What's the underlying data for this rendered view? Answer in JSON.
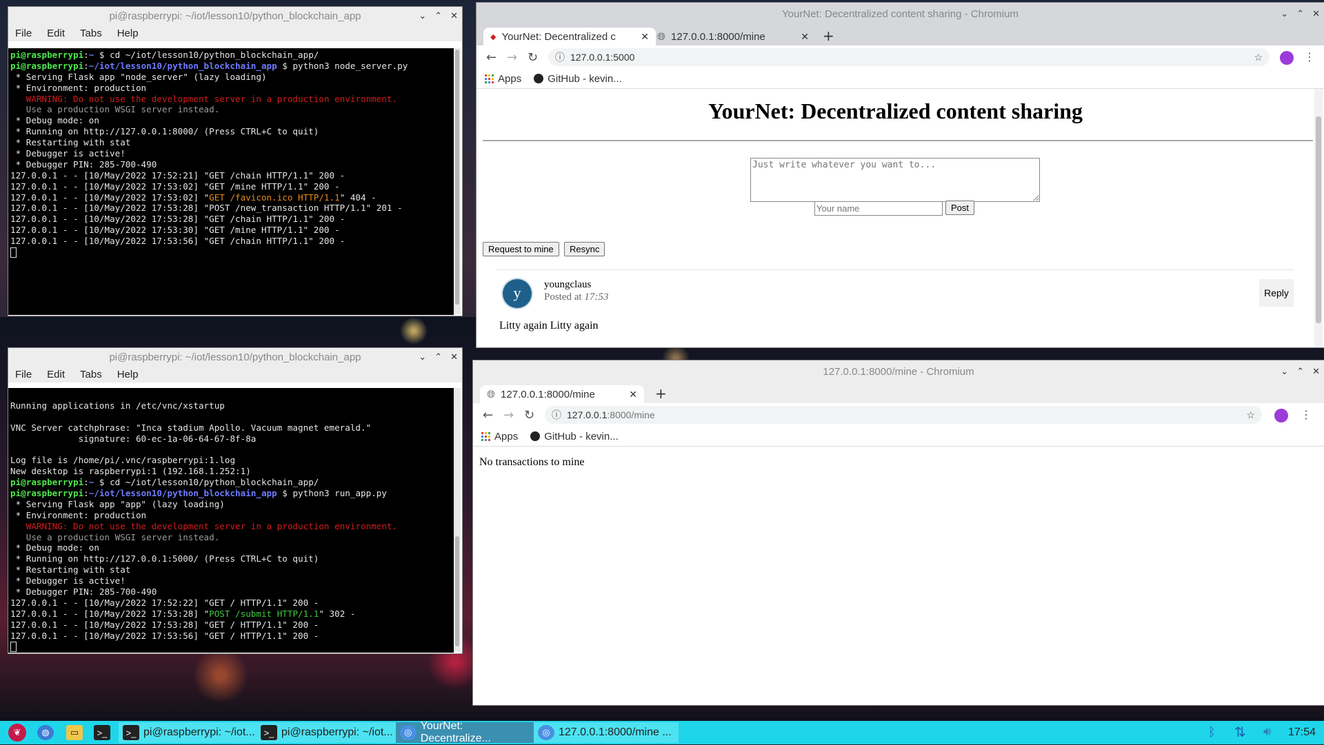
{
  "term1": {
    "title": "pi@raspberrypi: ~/iot/lesson10/python_blockchain_app",
    "menu": [
      "File",
      "Edit",
      "Tabs",
      "Help"
    ],
    "lines": [
      [
        [
          "pi@raspberrypi",
          "pg"
        ],
        [
          ":",
          ""
        ],
        [
          "~",
          "pb"
        ],
        [
          " $ cd ~/iot/lesson10/python_blockchain_app/",
          ""
        ]
      ],
      [
        [
          "pi@raspberrypi",
          "pg"
        ],
        [
          ":",
          ""
        ],
        [
          "~/iot/lesson10/python_blockchain_app",
          "pb"
        ],
        [
          " $ python3 node_server.py",
          ""
        ]
      ],
      [
        [
          " * Serving Flask app \"node_server\" (lazy loading)",
          ""
        ]
      ],
      [
        [
          " * Environment: production",
          ""
        ]
      ],
      [
        [
          "   WARNING: Do not use the development server in a production environment.",
          "red"
        ]
      ],
      [
        [
          "   Use a production WSGI server instead.",
          "gray"
        ]
      ],
      [
        [
          " * Debug mode: on",
          ""
        ]
      ],
      [
        [
          " * Running on http://127.0.0.1:8000/ (Press CTRL+C to quit)",
          ""
        ]
      ],
      [
        [
          " * Restarting with stat",
          ""
        ]
      ],
      [
        [
          " * Debugger is active!",
          ""
        ]
      ],
      [
        [
          " * Debugger PIN: 285-700-490",
          ""
        ]
      ],
      [
        [
          "127.0.0.1 - - [10/May/2022 17:52:21] \"GET /chain HTTP/1.1\" 200 -",
          ""
        ]
      ],
      [
        [
          "127.0.0.1 - - [10/May/2022 17:53:02] \"GET /mine HTTP/1.1\" 200 -",
          ""
        ]
      ],
      [
        [
          "127.0.0.1 - - [10/May/2022 17:53:02] \"",
          ""
        ],
        [
          "GET /favicon.ico HTTP/1.1",
          "ora"
        ],
        [
          "\" 404 -",
          ""
        ]
      ],
      [
        [
          "127.0.0.1 - - [10/May/2022 17:53:28] \"POST /new_transaction HTTP/1.1\" 201 -",
          ""
        ]
      ],
      [
        [
          "127.0.0.1 - - [10/May/2022 17:53:28] \"GET /chain HTTP/1.1\" 200 -",
          ""
        ]
      ],
      [
        [
          "127.0.0.1 - - [10/May/2022 17:53:30] \"GET /mine HTTP/1.1\" 200 -",
          ""
        ]
      ],
      [
        [
          "127.0.0.1 - - [10/May/2022 17:53:56] \"GET /chain HTTP/1.1\" 200 -",
          ""
        ]
      ]
    ]
  },
  "term2": {
    "title": "pi@raspberrypi: ~/iot/lesson10/python_blockchain_app",
    "menu": [
      "File",
      "Edit",
      "Tabs",
      "Help"
    ],
    "lines": [
      [
        [
          "",
          ""
        ]
      ],
      [
        [
          "Running applications in /etc/vnc/xstartup",
          ""
        ]
      ],
      [
        [
          "",
          ""
        ]
      ],
      [
        [
          "VNC Server catchphrase: \"Inca stadium Apollo. Vacuum magnet emerald.\"",
          ""
        ]
      ],
      [
        [
          "             signature: 60-ec-1a-06-64-67-8f-8a",
          ""
        ]
      ],
      [
        [
          "",
          ""
        ]
      ],
      [
        [
          "Log file is /home/pi/.vnc/raspberrypi:1.log",
          ""
        ]
      ],
      [
        [
          "New desktop is raspberrypi:1 (192.168.1.252:1)",
          ""
        ]
      ],
      [
        [
          "pi@raspberrypi",
          "pg"
        ],
        [
          ":",
          ""
        ],
        [
          "~",
          "pb"
        ],
        [
          " $ cd ~/iot/lesson10/python_blockchain_app/",
          ""
        ]
      ],
      [
        [
          "pi@raspberrypi",
          "pg"
        ],
        [
          ":",
          ""
        ],
        [
          "~/iot/lesson10/python_blockchain_app",
          "pb"
        ],
        [
          " $ python3 run_app.py",
          ""
        ]
      ],
      [
        [
          " * Serving Flask app \"app\" (lazy loading)",
          ""
        ]
      ],
      [
        [
          " * Environment: production",
          ""
        ]
      ],
      [
        [
          "   WARNING: Do not use the development server in a production environment.",
          "red"
        ]
      ],
      [
        [
          "   Use a production WSGI server instead.",
          "gray"
        ]
      ],
      [
        [
          " * Debug mode: on",
          ""
        ]
      ],
      [
        [
          " * Running on http://127.0.0.1:5000/ (Press CTRL+C to quit)",
          ""
        ]
      ],
      [
        [
          " * Restarting with stat",
          ""
        ]
      ],
      [
        [
          " * Debugger is active!",
          ""
        ]
      ],
      [
        [
          " * Debugger PIN: 285-700-490",
          ""
        ]
      ],
      [
        [
          "127.0.0.1 - - [10/May/2022 17:52:22] \"GET / HTTP/1.1\" 200 -",
          ""
        ]
      ],
      [
        [
          "127.0.0.1 - - [10/May/2022 17:53:28] \"",
          ""
        ],
        [
          "POST /submit HTTP/1.1",
          "grn"
        ],
        [
          "\" 302 -",
          ""
        ]
      ],
      [
        [
          "127.0.0.1 - - [10/May/2022 17:53:28] \"GET / HTTP/1.1\" 200 -",
          ""
        ]
      ],
      [
        [
          "127.0.0.1 - - [10/May/2022 17:53:56] \"GET / HTTP/1.1\" 200 -",
          ""
        ]
      ]
    ]
  },
  "browser1": {
    "title": "YourNet: Decentralized content sharing - Chromium",
    "tab1": "YourNet: Decentralized c",
    "tab2": "127.0.0.1:8000/mine",
    "url": "127.0.0.1:5000",
    "bookmarks": {
      "apps": "Apps",
      "github": "GitHub - kevin..."
    },
    "heading": "YourNet: Decentralized content sharing",
    "textarea_placeholder": "Just write whatever you want to...",
    "name_placeholder": "Your name",
    "post_btn": "Post",
    "request_btn": "Request to mine",
    "resync_btn": "Resync",
    "post": {
      "avatar": "y",
      "author": "youngclaus",
      "posted_label": "Posted at ",
      "time": "17:53",
      "reply": "Reply",
      "content": "Litty again Litty again"
    }
  },
  "browser2": {
    "title": "127.0.0.1:8000/mine - Chromium",
    "tab1": "127.0.0.1:8000/mine",
    "url_host": "127.0.0.1",
    "url_path": ":8000/mine",
    "bookmarks": {
      "apps": "Apps",
      "github": "GitHub - kevin..."
    },
    "message": "No transactions to mine"
  },
  "taskbar": {
    "task1": "pi@raspberrypi: ~/iot...",
    "task2": "pi@raspberrypi: ~/iot...",
    "task3": "YourNet: Decentralize...",
    "task4": "127.0.0.1:8000/mine ...",
    "clock": "17:54"
  },
  "colors": {
    "taskbar": "#1fd5ea",
    "avatar": "#1f5f8b",
    "prompt_user": "#4ee84e",
    "prompt_path": "#6f7bff"
  }
}
